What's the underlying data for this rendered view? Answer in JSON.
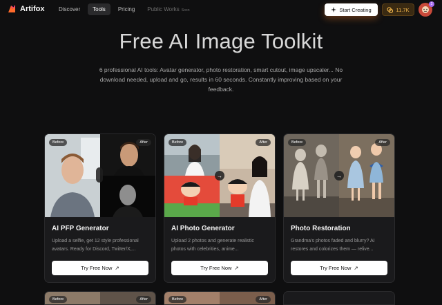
{
  "nav": {
    "brand": "Artifox",
    "links": [
      {
        "label": "Discover"
      },
      {
        "label": "Tools"
      },
      {
        "label": "Pricing"
      },
      {
        "label": "Public Works",
        "badge": "Soon"
      }
    ],
    "create_label": "Start Creating",
    "credits": "11.7K",
    "avatar_badge": "2"
  },
  "hero": {
    "title": "Free AI Image Toolkit",
    "subtitle": "6 professional AI tools: Avatar generator, photo restoration, smart cutout, image upscaler... No download needed, upload and go, results in 60 seconds. Constantly improving based on your feedback."
  },
  "cards": [
    {
      "title": "AI PFP Generator",
      "desc": "Upload a selfie, get 12 style professional avatars. Ready for Discord, Twitter/X,...",
      "before": "Before",
      "after": "After",
      "cta": "Try Free Now"
    },
    {
      "title": "AI Photo Generator",
      "desc": "Upload 2 photos and generate realistic photos with celebrities, anime...",
      "before": "Before",
      "after": "After",
      "cta": "Try Free Now"
    },
    {
      "title": "Photo Restoration",
      "desc": "Grandma's photos faded and blurry? AI restores and colorizes them — relive...",
      "before": "Before",
      "after": "After",
      "cta": "Try Free Now"
    }
  ],
  "bottom_cards": [
    {
      "before": "Before",
      "after": "After"
    },
    {
      "before": "Before",
      "after": "After"
    }
  ],
  "colors": {
    "background": "#0f0f10",
    "card": "#1a1a1c",
    "credits_text": "#f0b44a",
    "accent_glow": "#ff8228"
  }
}
